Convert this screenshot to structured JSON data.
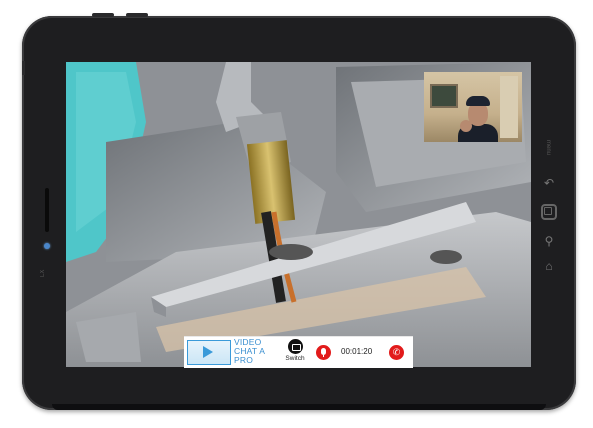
{
  "device": {
    "brand_mark": "LX",
    "menu_label": "menu",
    "hardware_icons": [
      "back-icon",
      "home-button-icon",
      "search-icon",
      "home-icon"
    ]
  },
  "call": {
    "logo": {
      "line1": "VIDEO",
      "line2": "CHAT A",
      "line3": "PRO"
    },
    "switch_label": "Switch",
    "timer": "00:01:20"
  },
  "colors": {
    "end_button": "#e21b1b",
    "mic_button": "#e21b1b",
    "logo_blue": "#3a8fd0",
    "tablet_body": "#1e1e20"
  }
}
